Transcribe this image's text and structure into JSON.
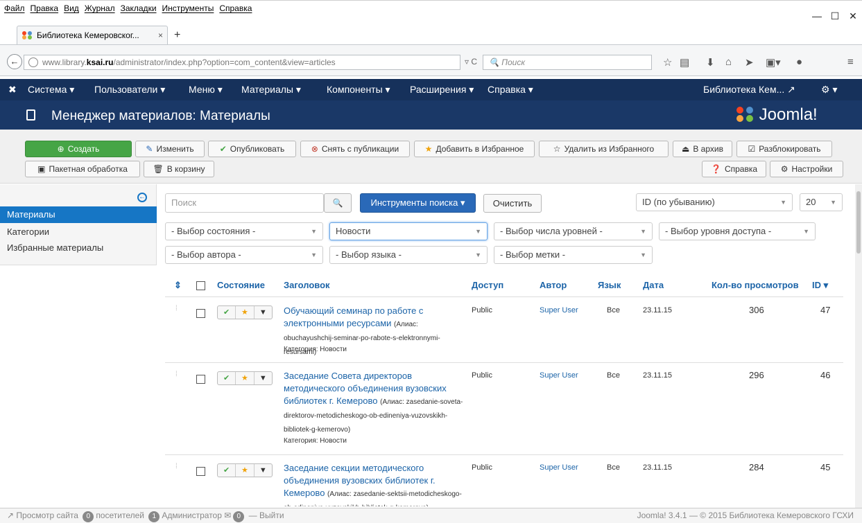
{
  "browser": {
    "menu": [
      "Файл",
      "Правка",
      "Вид",
      "Журнал",
      "Закладки",
      "Инструменты",
      "Справка"
    ],
    "tab_title": "Библиотека Кемеровског...",
    "tab_close": "×",
    "new_tab": "+",
    "url_prefix": "www.library.",
    "url_domain": "ksai.ru",
    "url_path": "/administrator/index.php?option=com_content&view=articles",
    "search_placeholder": "Поиск",
    "win_min": "—",
    "win_max": "☐",
    "win_close": "✕"
  },
  "jnav": {
    "items": [
      "Система ▾",
      "Пользователи ▾",
      "Меню ▾",
      "Материалы ▾",
      "Компоненты ▾",
      "Расширения ▾",
      "Справка ▾"
    ],
    "site": "Библиотека Кем... ↗",
    "settings": "⚙ ▾"
  },
  "header": {
    "title": "Менеджер материалов: Материалы",
    "logo": "Joomla!"
  },
  "toolbar": {
    "create": "Создать",
    "edit": "Изменить",
    "publish": "Опубликовать",
    "unpublish": "Снять с публикации",
    "feature": "Добавить в Избранное",
    "unfeature": "Удалить из Избранного",
    "archive": "В архив",
    "checkin": "Разблокировать",
    "batch": "Пакетная обработка",
    "trash": "В корзину",
    "help": "Справка",
    "options": "Настройки"
  },
  "sidebar": {
    "items": [
      {
        "label": "Материалы",
        "active": true
      },
      {
        "label": "Категории",
        "active": false
      },
      {
        "label": "Избранные материалы",
        "active": false
      }
    ]
  },
  "filters": {
    "search_placeholder": "Поиск",
    "search_tools": "Инструменты поиска ▾",
    "clear": "Очистить",
    "ordering": "ID (по убыванию)",
    "limit": "20",
    "state": "- Выбор состояния -",
    "category": "Новости",
    "levels": "- Выбор числа уровней -",
    "access": "- Выбор уровня доступа -",
    "author": "- Выбор автора -",
    "language": "- Выбор языка -",
    "tag": "- Выбор метки -"
  },
  "table": {
    "headers": {
      "sort": "⇕",
      "status": "Состояние",
      "title": "Заголовок",
      "access": "Доступ",
      "author": "Автор",
      "language": "Язык",
      "date": "Дата",
      "hits": "Кол-во просмотров",
      "id": "ID ▾"
    },
    "rows": [
      {
        "title": "Обучающий семинар по работе с электронными ресурсами",
        "alias": "(Алиас: obuchayushchij-seminar-po-rabote-s-elektronnymi-resursami)",
        "category": "Категория: Новости",
        "access": "Public",
        "author": "Super User",
        "language": "Все",
        "date": "23.11.15",
        "hits": "306",
        "id": "47"
      },
      {
        "title": "Заседание Совета директоров методического объединения вузовских библиотек г. Кемерово",
        "alias": "(Алиас: zasedanie-soveta-direktorov-metodicheskogo-ob-edineniya-vuzovskikh-bibliotek-g-kemerovo)",
        "category": "Категория: Новости",
        "access": "Public",
        "author": "Super User",
        "language": "Все",
        "date": "23.11.15",
        "hits": "296",
        "id": "46"
      },
      {
        "title": "Заседание секции методического объединения вузовских библиотек г. Кемерово",
        "alias": "(Алиас: zasedanie-sektsii-metodicheskogo-ob-edineniya-vuzovskikh-bibliotek-g-kemerovo)",
        "category": "",
        "access": "Public",
        "author": "Super User",
        "language": "Все",
        "date": "23.11.15",
        "hits": "284",
        "id": "45"
      }
    ]
  },
  "footer": {
    "view_site": "Просмотр сайта",
    "visitors_count": "0",
    "visitors": "посетителей",
    "admins_count": "1",
    "admins": "Администратор",
    "messages_count": "0",
    "logout": "Выйти",
    "copyright": "Joomla! 3.4.1 — © 2015 Библиотека Кемеровского ГСХИ"
  },
  "colors": {
    "nav_bg": "#16315b",
    "header_bg": "#1a3867",
    "green": "#46a546",
    "blue": "#2a69b8",
    "link": "#1c64a8"
  }
}
